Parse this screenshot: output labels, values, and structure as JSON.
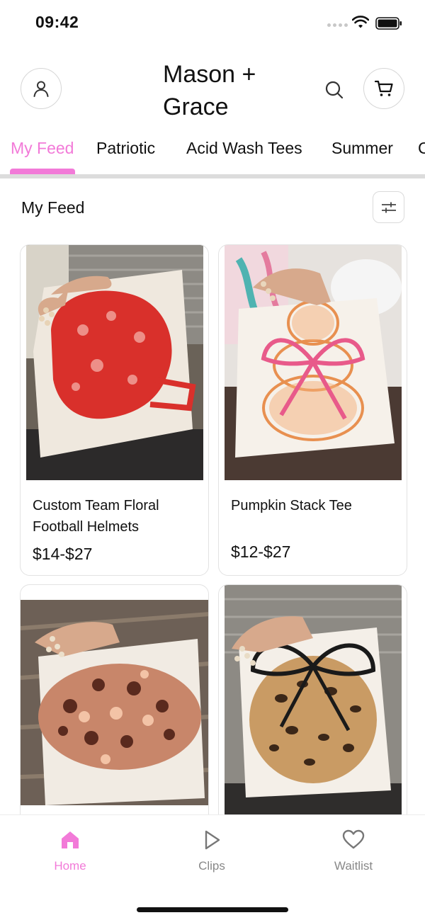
{
  "status": {
    "time": "09:42"
  },
  "header": {
    "brand": "Mason + Grace",
    "icons": [
      "profile-icon",
      "search-icon",
      "cart-icon"
    ]
  },
  "tabs": [
    {
      "label": "My Feed",
      "active": true
    },
    {
      "label": "Patriotic",
      "active": false
    },
    {
      "label": "Acid Wash Tees",
      "active": false
    },
    {
      "label": "Summer",
      "active": false
    },
    {
      "label": "C",
      "active": false
    }
  ],
  "section": {
    "title": "My Feed"
  },
  "products": [
    {
      "name": "Custom Team Floral Football Helmets",
      "price": "$14-$27"
    },
    {
      "name": "Pumpkin Stack Tee",
      "price": "$12-$27"
    },
    {
      "name": "",
      "price": ""
    },
    {
      "name": "",
      "price": ""
    }
  ],
  "bottom_nav": [
    {
      "label": "Home",
      "icon": "home-icon",
      "active": true
    },
    {
      "label": "Clips",
      "icon": "play-icon",
      "active": false
    },
    {
      "label": "Waitlist",
      "icon": "heart-icon",
      "active": false
    }
  ],
  "colors": {
    "accent": "#f27ad8",
    "text": "#111111",
    "muted": "#888888"
  }
}
